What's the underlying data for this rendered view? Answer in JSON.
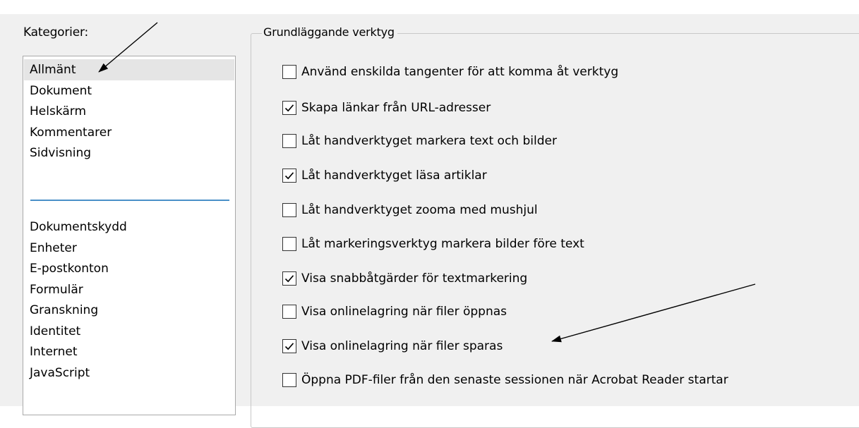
{
  "categories": {
    "label": "Kategorier:",
    "group1": [
      {
        "label": "Allmänt",
        "selected": true
      },
      {
        "label": "Dokument",
        "selected": false
      },
      {
        "label": "Helskärm",
        "selected": false
      },
      {
        "label": "Kommentarer",
        "selected": false
      },
      {
        "label": "Sidvisning",
        "selected": false
      }
    ],
    "group2": [
      {
        "label": "Dokumentskydd",
        "selected": false
      },
      {
        "label": "Enheter",
        "selected": false
      },
      {
        "label": "E-postkonton",
        "selected": false
      },
      {
        "label": "Formulär",
        "selected": false
      },
      {
        "label": "Granskning",
        "selected": false
      },
      {
        "label": "Identitet",
        "selected": false
      },
      {
        "label": "Internet",
        "selected": false
      },
      {
        "label": "JavaScript",
        "selected": false
      }
    ]
  },
  "basic_tools": {
    "legend": "Grundläggande verktyg",
    "options": [
      {
        "label": "Använd enskilda tangenter för att komma åt verktyg",
        "checked": false
      },
      {
        "label": "Skapa länkar från URL-adresser",
        "checked": true
      },
      {
        "label": "Låt handverktyget markera text och bilder",
        "checked": false
      },
      {
        "label": "Låt handverktyget läsa artiklar",
        "checked": true
      },
      {
        "label": "Låt handverktyget zooma med mushjul",
        "checked": false
      },
      {
        "label": "Låt markeringsverktyg markera bilder före text",
        "checked": false
      },
      {
        "label": "Visa snabbåtgärder för textmarkering",
        "checked": true
      },
      {
        "label": "Visa onlinelagring när filer öppnas",
        "checked": false
      },
      {
        "label": "Visa onlinelagring när filer sparas",
        "checked": true
      },
      {
        "label": "Öppna PDF-filer från den senaste sessionen när Acrobat Reader startar",
        "checked": false
      }
    ]
  },
  "colors": {
    "selection": "#e5e5e5",
    "divider": "#4a90c8",
    "dialog_bg": "#f0f0f0"
  }
}
